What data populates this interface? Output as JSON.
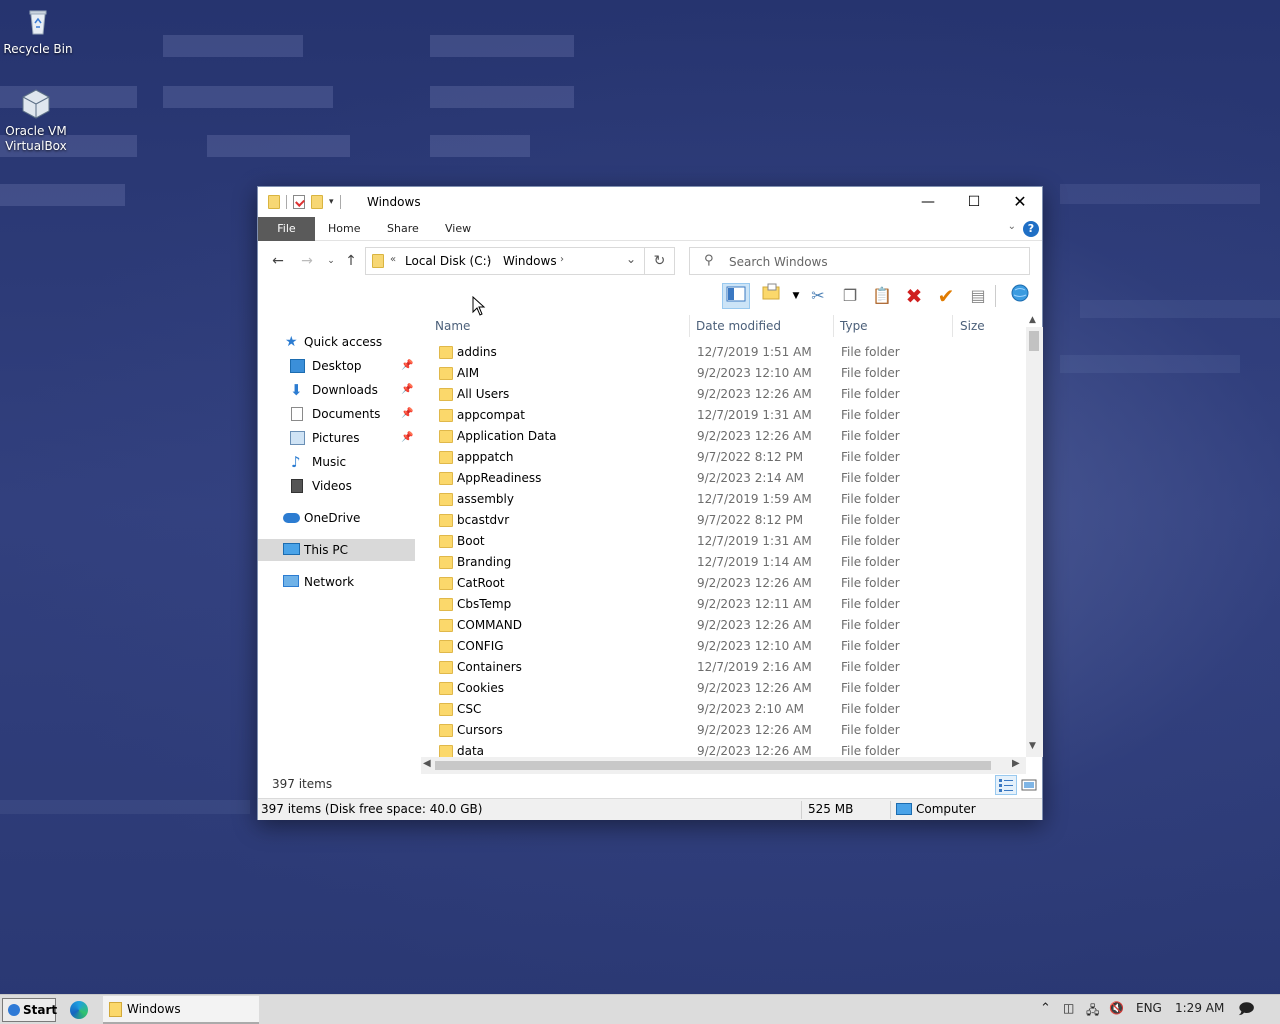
{
  "desktop": {
    "icons": [
      {
        "label_line1": "Recycle Bin",
        "label_line2": ""
      },
      {
        "label_line1": "Oracle VM",
        "label_line2": "VirtualBox"
      }
    ]
  },
  "window": {
    "title": "Windows",
    "ribbon_tabs": {
      "file": "File",
      "home": "Home",
      "share": "Share",
      "view": "View"
    },
    "help": "?",
    "address": {
      "overflow": "«",
      "segments": [
        "Local Disk (C:)",
        "Windows"
      ]
    },
    "search_placeholder": "Search Windows",
    "nav_pane": {
      "quick_access": "Quick access",
      "desktop": "Desktop",
      "downloads": "Downloads",
      "documents": "Documents",
      "pictures": "Pictures",
      "music": "Music",
      "videos": "Videos",
      "onedrive": "OneDrive",
      "this_pc": "This PC",
      "network": "Network"
    },
    "columns": {
      "name": "Name",
      "date": "Date modified",
      "type": "Type",
      "size": "Size"
    },
    "files": [
      {
        "name": "addins",
        "date": "12/7/2019 1:51 AM",
        "type": "File folder"
      },
      {
        "name": "AIM",
        "date": "9/2/2023 12:10 AM",
        "type": "File folder"
      },
      {
        "name": "All Users",
        "date": "9/2/2023 12:26 AM",
        "type": "File folder"
      },
      {
        "name": "appcompat",
        "date": "12/7/2019 1:31 AM",
        "type": "File folder"
      },
      {
        "name": "Application Data",
        "date": "9/2/2023 12:26 AM",
        "type": "File folder"
      },
      {
        "name": "apppatch",
        "date": "9/7/2022 8:12 PM",
        "type": "File folder"
      },
      {
        "name": "AppReadiness",
        "date": "9/2/2023 2:14 AM",
        "type": "File folder"
      },
      {
        "name": "assembly",
        "date": "12/7/2019 1:59 AM",
        "type": "File folder"
      },
      {
        "name": "bcastdvr",
        "date": "9/7/2022 8:12 PM",
        "type": "File folder"
      },
      {
        "name": "Boot",
        "date": "12/7/2019 1:31 AM",
        "type": "File folder"
      },
      {
        "name": "Branding",
        "date": "12/7/2019 1:14 AM",
        "type": "File folder"
      },
      {
        "name": "CatRoot",
        "date": "9/2/2023 12:26 AM",
        "type": "File folder"
      },
      {
        "name": "CbsTemp",
        "date": "9/2/2023 12:11 AM",
        "type": "File folder"
      },
      {
        "name": "COMMAND",
        "date": "9/2/2023 12:26 AM",
        "type": "File folder"
      },
      {
        "name": "CONFIG",
        "date": "9/2/2023 12:10 AM",
        "type": "File folder"
      },
      {
        "name": "Containers",
        "date": "12/7/2019 2:16 AM",
        "type": "File folder"
      },
      {
        "name": "Cookies",
        "date": "9/2/2023 12:26 AM",
        "type": "File folder"
      },
      {
        "name": "CSC",
        "date": "9/2/2023 2:10 AM",
        "type": "File folder"
      },
      {
        "name": "Cursors",
        "date": "9/2/2023 12:26 AM",
        "type": "File folder"
      },
      {
        "name": "data",
        "date": "9/2/2023 12:26 AM",
        "type": "File folder"
      }
    ],
    "item_count": "397 items",
    "status": {
      "left": "397 items (Disk free space: 40.0 GB)",
      "size": "525 MB",
      "location": "Computer"
    }
  },
  "taskbar": {
    "start": "Start",
    "task_label": "Windows",
    "language": "ENG",
    "clock": "1:29 AM"
  },
  "colors": {
    "accent": "#1f6fc5",
    "folder": "#fbd86b",
    "selected_nav": "#d9d9d9"
  }
}
